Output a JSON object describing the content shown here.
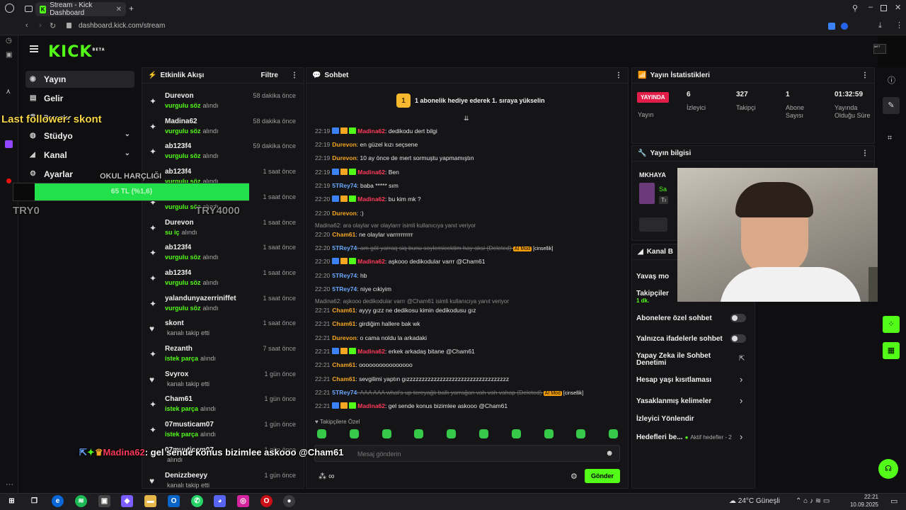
{
  "browser": {
    "tab_title": "Stream - Kick Dashboard",
    "url": "dashboard.kick.com/stream"
  },
  "app": {
    "logo": "KICK",
    "logo_tag": "BETA"
  },
  "nav": [
    {
      "label": "Yayın",
      "icon": "broadcast-icon"
    },
    {
      "label": "Gelir",
      "icon": "money-icon"
    },
    {
      "label": "Başarılar",
      "icon": "trophy-icon"
    },
    {
      "label": "Stüdyo",
      "icon": "studio-icon"
    },
    {
      "label": "Kanal",
      "icon": "channel-icon"
    },
    {
      "label": "Ayarlar",
      "icon": "gear-icon"
    }
  ],
  "overlay": {
    "last_follower": "Last follower: skont",
    "goal_label": "OKUL HARÇLIĞI",
    "goal_bar": "65 TL (%1,6)",
    "try_left": "TRY0",
    "try_right": "TRY4000",
    "chat_popup_user": "Madina62",
    "chat_popup_msg": ": gel sende konus bizimlee askooo @Cham61"
  },
  "activity": {
    "title": "Etkinlik Akışı",
    "filter": "Filtre",
    "items": [
      {
        "name": "Durevon",
        "verb": "vurgulu söz",
        "suffix": "alındı",
        "time": "58 dakika önce",
        "icon": "gift"
      },
      {
        "name": "Madina62",
        "verb": "vurgulu söz",
        "suffix": "alındı",
        "time": "58 dakika önce",
        "icon": "gift"
      },
      {
        "name": "ab123f4",
        "verb": "vurgulu söz",
        "suffix": "alındı",
        "time": "59 dakika önce",
        "icon": "gift"
      },
      {
        "name": "ab123f4",
        "verb": "vurgulu söz",
        "suffix": "alındı",
        "time": "1 saat önce",
        "icon": "gift"
      },
      {
        "name": "",
        "verb": "vurgulu söz",
        "suffix": "alındı",
        "time": "1 saat önce",
        "icon": "gift"
      },
      {
        "name": "Durevon",
        "verb": "su iç",
        "suffix": "alındı",
        "time": "1 saat önce",
        "icon": "gift"
      },
      {
        "name": "ab123f4",
        "verb": "vurgulu söz",
        "suffix": "alındı",
        "time": "1 saat önce",
        "icon": "gift"
      },
      {
        "name": "ab123f4",
        "verb": "vurgulu söz",
        "suffix": "alındı",
        "time": "1 saat önce",
        "icon": "gift"
      },
      {
        "name": "yalandunyazerriniffet",
        "verb": "vurgulu söz",
        "suffix": "alındı",
        "time": "1 saat önce",
        "icon": "gift"
      },
      {
        "name": "skont",
        "verb": "",
        "suffix": "kanalı takip etti",
        "time": "1 saat önce",
        "icon": "heart"
      },
      {
        "name": "Rezanth",
        "verb": "istek parça",
        "suffix": "alındı",
        "time": "7 saat önce",
        "icon": "gift"
      },
      {
        "name": "Svyrox",
        "verb": "",
        "suffix": "kanalı takip etti",
        "time": "1 gün önce",
        "icon": "heart"
      },
      {
        "name": "Cham61",
        "verb": "istek parça",
        "suffix": "alındı",
        "time": "1 gün önce",
        "icon": "gift"
      },
      {
        "name": "07musticam07",
        "verb": "istek parça",
        "suffix": "alındı",
        "time": "1 gün önce",
        "icon": "gift"
      },
      {
        "name": "07musticam07",
        "verb": "",
        "suffix": "alındı",
        "time": "1 gün önce",
        "icon": "gift"
      },
      {
        "name": "Denizzbeeyy",
        "verb": "",
        "suffix": "kanalı takip etti",
        "time": "1 gün önce",
        "icon": "heart"
      }
    ]
  },
  "chat": {
    "title": "Sohbet",
    "pinned": "1 abonelik hediye ederek 1. sıraya yükselin",
    "pinned_num": "1",
    "messages": [
      {
        "time": "22:19",
        "user": "Madina62",
        "color": "#ff3b5c",
        "badges": true,
        "text": ": dedikodu dert bilgi"
      },
      {
        "time": "22:19",
        "user": "Durevon",
        "color": "#f5a623",
        "badges": false,
        "text": ": en güzel kızı seçsene"
      },
      {
        "time": "22:19",
        "user": "Durevon",
        "color": "#f5a623",
        "badges": false,
        "text": ": 10 ay önce de mert sormuştu yapmamıştın"
      },
      {
        "time": "22:19",
        "user": "Madina62",
        "color": "#ff3b5c",
        "badges": true,
        "text": ": Ben"
      },
      {
        "time": "22:19",
        "user": "5TRey74",
        "color": "#6aa8ff",
        "badges": false,
        "text": ": baba ***** sım"
      },
      {
        "time": "22:20",
        "user": "Madina62",
        "color": "#ff3b5c",
        "badges": true,
        "text": ": bu kim mk ?"
      },
      {
        "time": "22:20",
        "user": "Durevon",
        "color": "#f5a623",
        "badges": false,
        "text": ": :)"
      },
      {
        "time": "22:20",
        "user": "Cham61",
        "color": "#f5a623",
        "badges": false,
        "text": ": ne olaylar varrrrrrrrrr",
        "reply": "Madina62: ara olaylar var olaylarrr isimli kullanıcıya yanıt veriyor"
      },
      {
        "time": "22:20",
        "user": "5TRey74",
        "color": "#6aa8ff",
        "badges": false,
        "text": ": am göt yarraq siq bunu soylemicektim hay aksi (Deleted) ",
        "deleted": true,
        "tag": "AI Mod",
        "tag2": "[cinsellik]"
      },
      {
        "time": "22:20",
        "user": "Madina62",
        "color": "#ff3b5c",
        "badges": true,
        "text": ": aşkooo dedikodular varrr @Cham61"
      },
      {
        "time": "22:20",
        "user": "5TRey74",
        "color": "#6aa8ff",
        "badges": false,
        "text": ": hb"
      },
      {
        "time": "22:20",
        "user": "5TRey74",
        "color": "#6aa8ff",
        "badges": false,
        "text": ": niye cıkiyim"
      },
      {
        "time": "22:21",
        "user": "Cham61",
        "color": "#f5a623",
        "badges": false,
        "text": ": ayyy gızz ne dedikosu kimin dedikodusu gız",
        "reply": "Madina62: aşkooo dedikodular varrr @Cham61 isimli kullanıcıya yanıt veriyor"
      },
      {
        "time": "22:21",
        "user": "Cham61",
        "color": "#f5a623",
        "badges": false,
        "text": ": girdiğim hallere bak wk"
      },
      {
        "time": "22:21",
        "user": "Durevon",
        "color": "#f5a623",
        "badges": false,
        "text": ": o cama noldu la arkadaki"
      },
      {
        "time": "22:21",
        "user": "Madina62",
        "color": "#ff3b5c",
        "badges": true,
        "text": ": erkek arkadaş bitane @Cham61"
      },
      {
        "time": "22:21",
        "user": "Cham61",
        "color": "#f5a623",
        "badges": false,
        "text": ": oooooooooooooooo"
      },
      {
        "time": "22:21",
        "user": "Cham61",
        "color": "#f5a623",
        "badges": false,
        "text": ": sevgilimi yaptın gızzzzzzzzzzzzzzzzzzzzzzzzzzzzzzzzzz"
      },
      {
        "time": "22:21",
        "user": "5TRey74",
        "color": "#6aa8ff",
        "badges": false,
        "text": ": AAA AAA what's up tereyağlı ballı yarrağan vah vah vahap (Deleted) ",
        "deleted": true,
        "tag": "AI Mod",
        "tag2": "[cinsellik]"
      },
      {
        "time": "22:21",
        "user": "Madina62",
        "color": "#ff3b5c",
        "badges": true,
        "text": ": gel sende konus bizimlee askooo @Cham61"
      }
    ],
    "followers_only": "Takipçilere Özel",
    "input_placeholder": "Mesaj gönderin",
    "send": "Gönder"
  },
  "stats": {
    "title": "Yayın İstatistikleri",
    "live": "YAYINDA",
    "live_sub": "Yayın",
    "viewers": "6",
    "viewers_label": "İzleyici",
    "followers": "327",
    "followers_label": "Takipçi",
    "subs": "1",
    "subs_label": "Abone Sayısı",
    "uptime": "01:32:59",
    "uptime_label": "Yayında Olduğu Süre"
  },
  "stream_info": {
    "title": "Yayın bilgisi",
    "name": "MKHAYA",
    "cat": "Sa",
    "cat_tag": "Tı"
  },
  "channel": {
    "title": "Kanal B",
    "slow": "Yavaş mo",
    "followers": "Takipçiler",
    "followers_val": "1 dk.",
    "subs_only": "Abonelere özel sohbet",
    "emote_only": "Yalnızca ifadelerle sohbet",
    "ai_mod": "Yapay Zeka ile Sohbet Denetimi",
    "age": "Hesap yaşı kısıtlaması",
    "banned": "Yasaklanmış kelimeler",
    "redirect": "İzleyici Yönlendir",
    "goals": "Hedefleri be...",
    "goals_active": "Aktif hedefler - 2"
  },
  "taskbar": {
    "weather": "24°C Güneşli",
    "time": "22:21",
    "date": "10.09.2025"
  }
}
